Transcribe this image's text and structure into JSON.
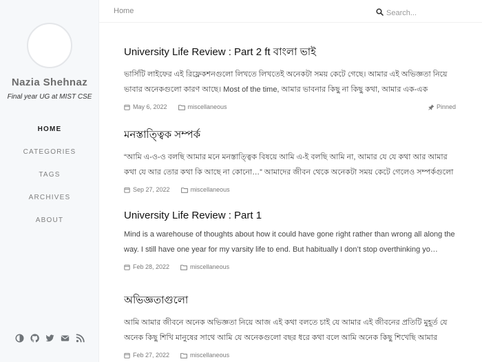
{
  "sidebar": {
    "name": "Nazia Shehnaz",
    "tagline": "Final year UG at MIST CSE",
    "nav": [
      {
        "label": "HOME"
      },
      {
        "label": "CATEGORIES"
      },
      {
        "label": "TAGS"
      },
      {
        "label": "ARCHIVES"
      },
      {
        "label": "ABOUT"
      }
    ],
    "footer_icons": [
      "theme-toggle-icon",
      "github-icon",
      "twitter-icon",
      "email-icon",
      "rss-icon"
    ]
  },
  "topbar": {
    "breadcrumb": "Home",
    "search_placeholder": "Search..."
  },
  "posts": [
    {
      "title": "University Life Review : Part 2 ft বাংলা ভাই",
      "excerpt": "ভার্সিটি লাইফের এই রিফ্লেকশনগুলো লিখতে লিখতেই অনেকটা সময় কেটে গেছে। আমার এই অভিজ্ঞতা নিয়ে ভাবার অনেকগুলো কারণ আছে। Most of the time, আমার ভাবনার কিছু না কিছু কথা, আমার এক-এক ভাবনা…",
      "date": "May 6, 2022",
      "category": "miscellaneous",
      "pinned": "Pinned"
    },
    {
      "title": "মনস্তাত্ত্বিক সম্পর্ক",
      "excerpt": "“আমি এ-ও-ও বলছি আমার মনে মনস্তাত্ত্বিক বিষয়ে আমি এ-ই বলছি আমি না, আমার যে যে কথা আর আমার কথা যে আর তোর কথা কি আছে না কোনো…” আমাদের জীবন থেকে অনেকটা সময় কেটে গেলেও সম্পর্কগুলো আমাদের কি ভাবে ভাবায় …",
      "date": "Sep 27, 2022",
      "category": "miscellaneous"
    },
    {
      "title": "University Life Review : Part 1",
      "excerpt": "Mind is a warehouse of thoughts about how it could have gone right rather than wrong all along the way. I still have one year for my varsity life to end. But habitually I don’t stop overthinking yo…",
      "date": "Feb 28, 2022",
      "category": "miscellaneous"
    },
    {
      "title": "অভিজ্ঞতাগুলো",
      "excerpt": "আমি আমার জীবনে অনেক অভিজ্ঞতা নিয়ে আজ এই কথা বলতে চাই যে আমার এই জীবনের প্রতিটি মুহূর্ত যে অনেক কিছু শিখি মানুষের সাথে আমি যে অনেকগুলো বছর ধরে কথা বলে আমি অনেক কিছু শিখেছি আমার অভিজ্ঞতাগুলোর কথা লিখছি …",
      "date": "Feb 27, 2022",
      "category": "miscellaneous"
    }
  ]
}
